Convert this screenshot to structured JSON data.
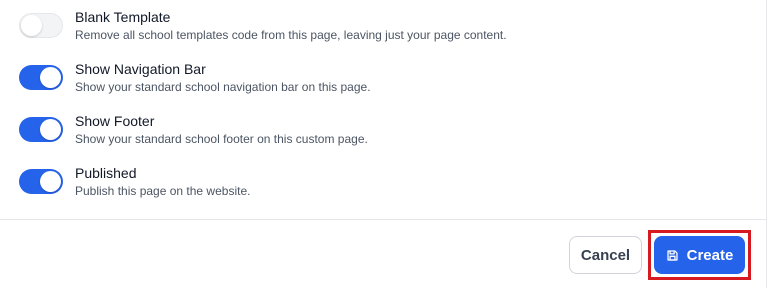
{
  "settings": [
    {
      "label": "Blank Template",
      "description": "Remove all school templates code from this page, leaving just your page content.",
      "enabled": false
    },
    {
      "label": "Show Navigation Bar",
      "description": "Show your standard school navigation bar on this page.",
      "enabled": true
    },
    {
      "label": "Show Footer",
      "description": "Show your standard school footer on this custom page.",
      "enabled": true
    },
    {
      "label": "Published",
      "description": "Publish this page on the website.",
      "enabled": true
    }
  ],
  "footer": {
    "cancel_label": "Cancel",
    "create_label": "Create",
    "create_icon": "save-icon"
  },
  "colors": {
    "accent": "#2563eb",
    "highlight": "#d71920"
  }
}
